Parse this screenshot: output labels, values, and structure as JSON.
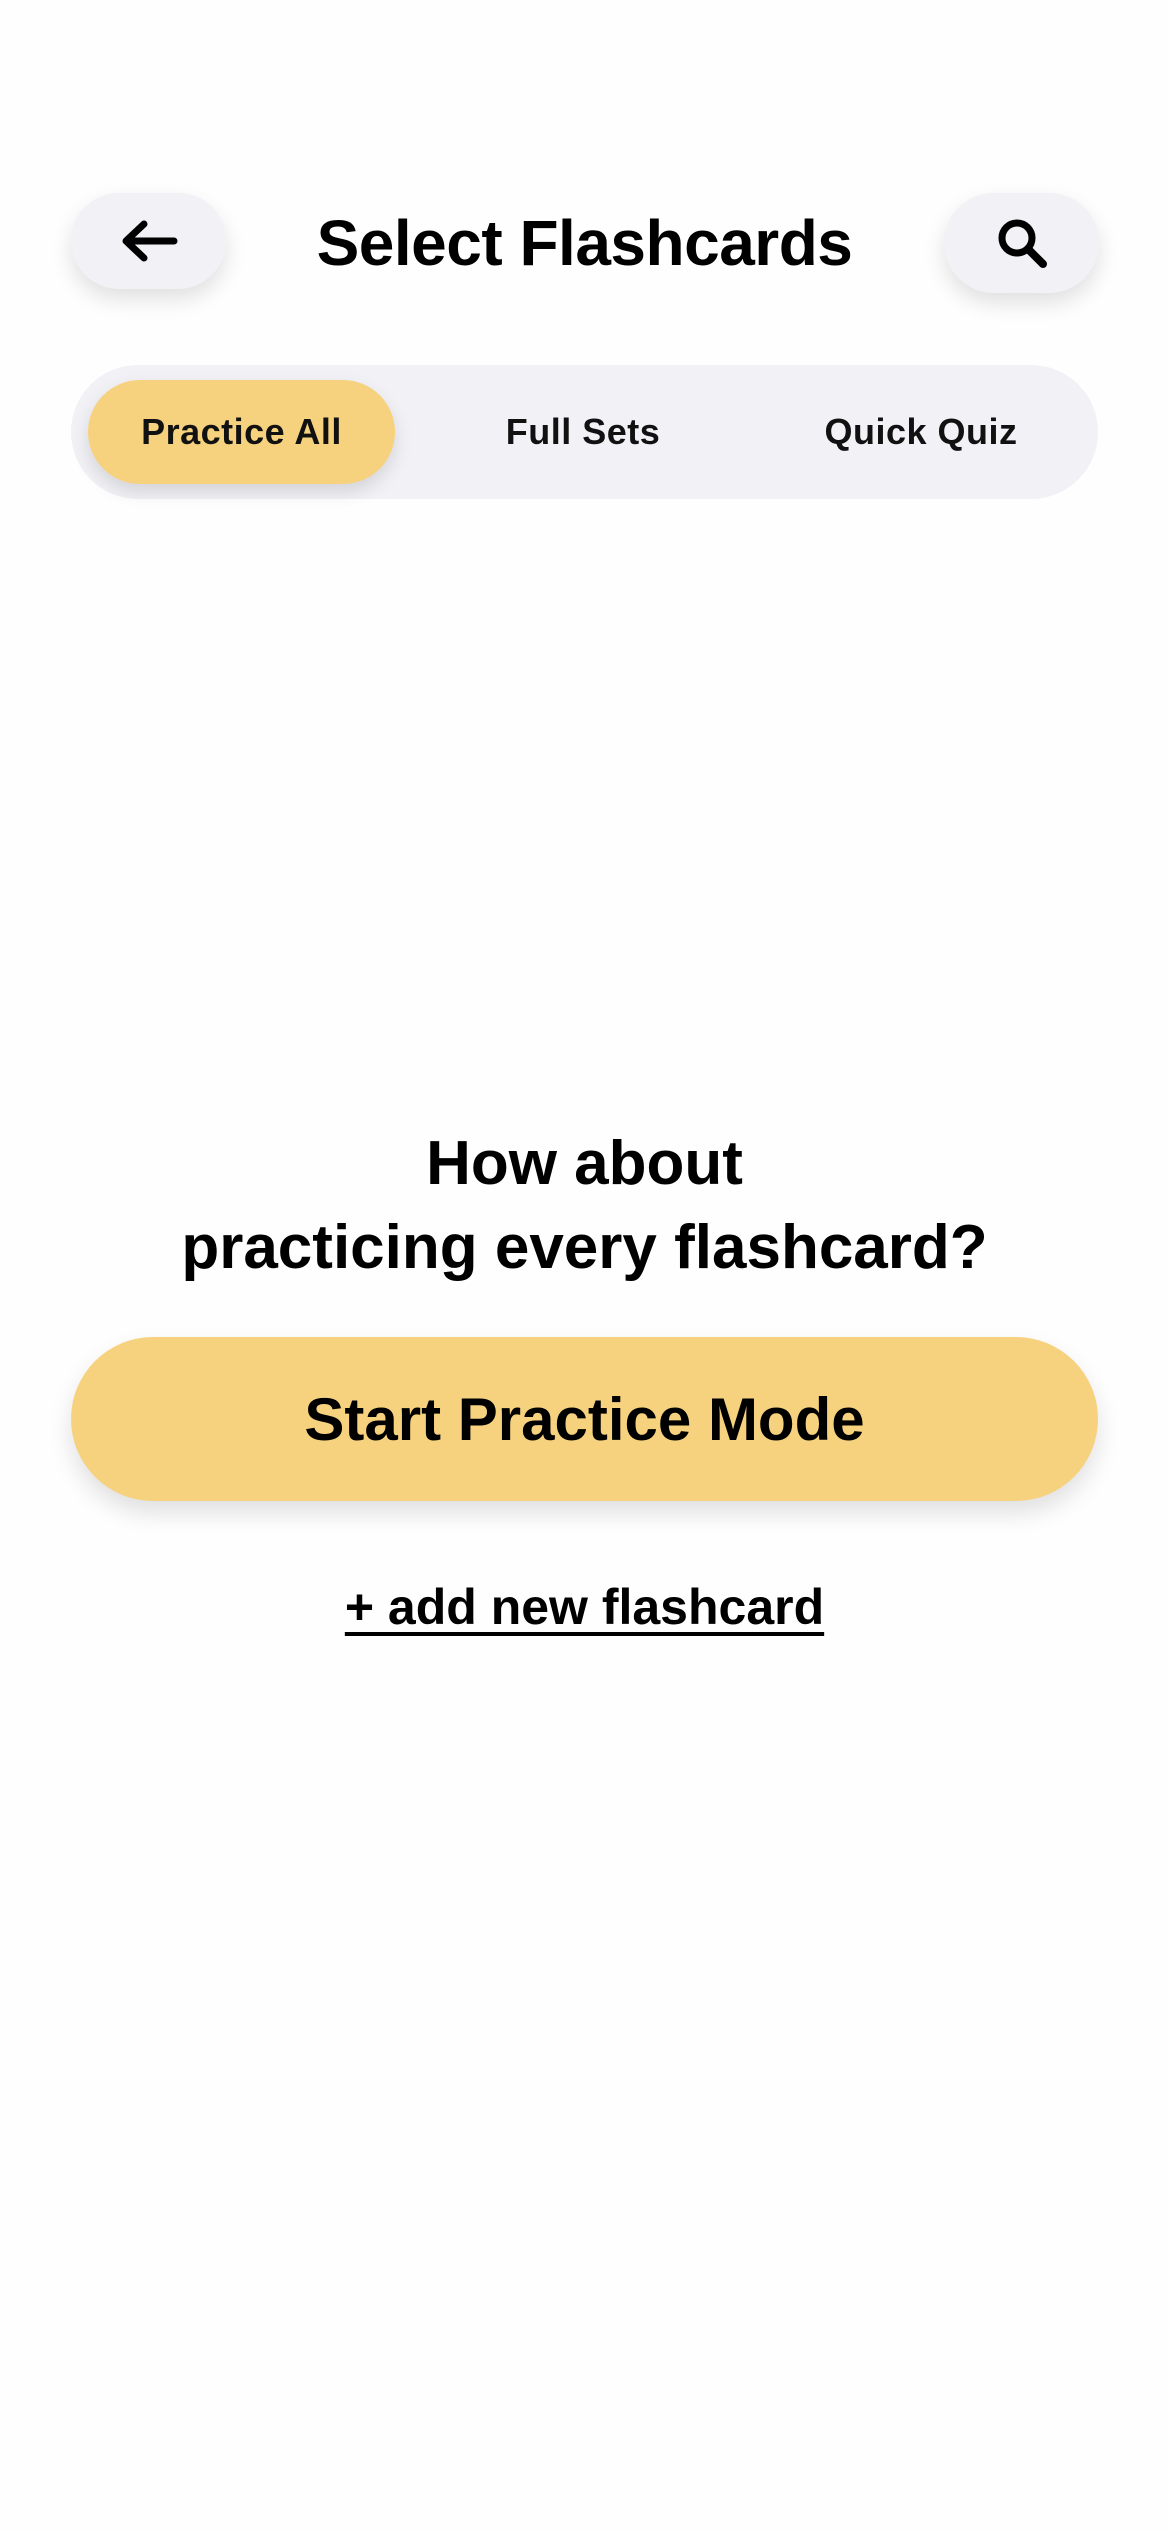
{
  "header": {
    "title": "Select Flashcards",
    "back_icon": "arrow-left-icon",
    "search_icon": "search-icon"
  },
  "tabs": [
    {
      "label": "Practice All",
      "selected": true
    },
    {
      "label": "Full Sets",
      "selected": false
    },
    {
      "label": "Quick Quiz",
      "selected": false
    }
  ],
  "empty_state": {
    "line1": "How about",
    "line2": "practicing every flashcard?",
    "start_button": "Start Practice Mode",
    "add_link": "+ add new flashcard"
  },
  "colors": {
    "accent": "#f7d27e",
    "control_bg": "#f1f1f6",
    "text": "#000000"
  }
}
